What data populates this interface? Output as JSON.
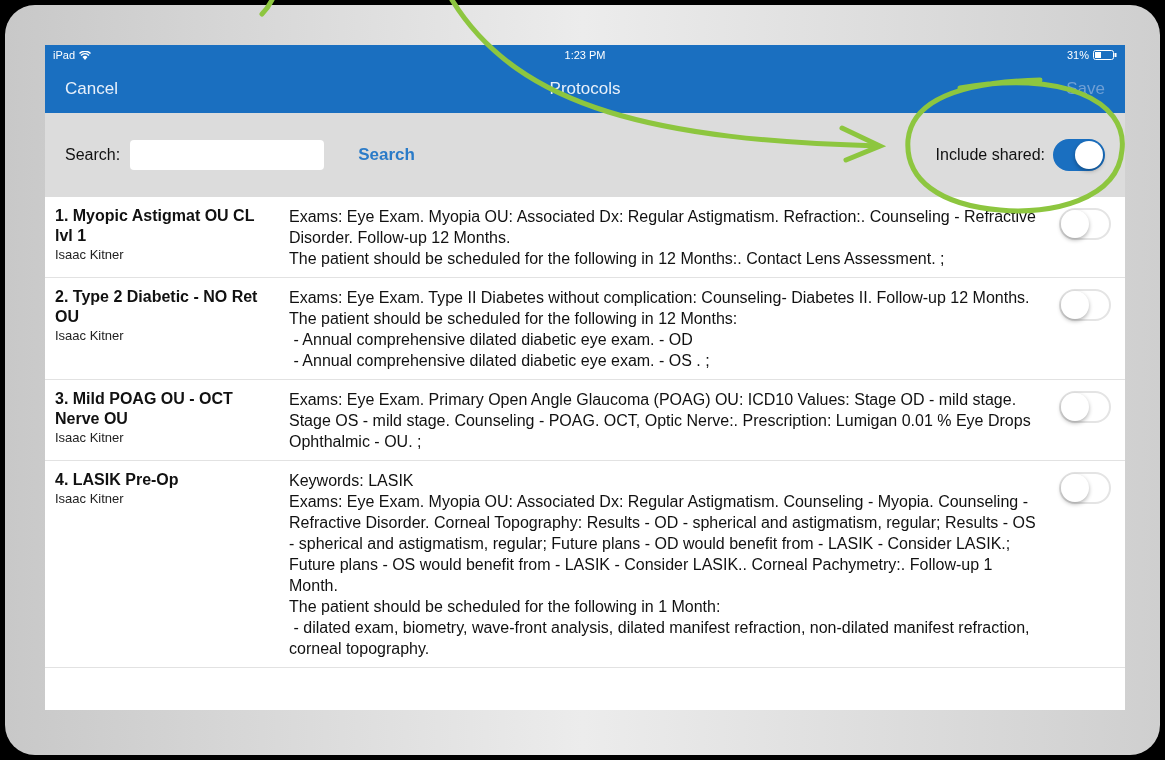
{
  "status_bar": {
    "device": "iPad",
    "time": "1:23 PM",
    "battery": "31%"
  },
  "nav_bar": {
    "cancel": "Cancel",
    "title": "Protocols",
    "save": {
      "label": "Save",
      "disabled": true
    }
  },
  "search_bar": {
    "label": "Search:",
    "button": "Search",
    "include_shared": {
      "label": "Include shared:",
      "on": true
    }
  },
  "protocols": [
    {
      "title": "1. Myopic Astigmat OU CL lvl 1",
      "author": "Isaac Kitner",
      "on": false,
      "description": [
        "Exams: Eye Exam. Myopia OU: Associated Dx: Regular Astigmatism. Refraction:. Counseling - Refractive Disorder. Follow-up 12 Months.",
        "The patient should be scheduled for the following in 12 Months:. Contact Lens Assessment. ;"
      ]
    },
    {
      "title": "2. Type 2 Diabetic - NO Ret OU",
      "author": "Isaac Kitner",
      "on": false,
      "description": [
        "Exams: Eye Exam. Type II Diabetes without complication: Counseling- Diabetes II. Follow-up 12 Months.",
        "The patient should be scheduled for the following in 12 Months:",
        " - Annual comprehensive dilated diabetic eye exam. - OD",
        " - Annual comprehensive dilated diabetic eye exam. - OS . ;"
      ]
    },
    {
      "title": "3. Mild POAG OU - OCT Nerve OU",
      "author": "Isaac Kitner",
      "on": false,
      "description": [
        "Exams: Eye Exam. Primary Open Angle Glaucoma (POAG) OU: ICD10 Values: Stage OD - mild stage. Stage OS - mild stage. Counseling - POAG. OCT, Optic Nerve:. Prescription: Lumigan 0.01 % Eye Drops Ophthalmic - OU. ;"
      ]
    },
    {
      "title": "4. LASIK Pre-Op",
      "author": "Isaac Kitner",
      "on": false,
      "description": [
        "Keywords: LASIK",
        "Exams: Eye Exam. Myopia OU: Associated Dx: Regular Astigmatism. Counseling - Myopia. Counseling - Refractive Disorder. Corneal Topography: Results - OD - spherical and astigmatism, regular; Results - OS - spherical and astigmatism, regular; Future plans - OD would benefit from - LASIK - Consider LASIK.; Future plans - OS would benefit from - LASIK - Consider LASIK.. Corneal Pachymetry:. Follow-up 1 Month.",
        "The patient should be scheduled for the following in 1 Month:",
        " - dilated exam, biometry, wave-front analysis, dilated manifest refraction, non-dilated manifest refraction, corneal topography."
      ]
    }
  ]
}
